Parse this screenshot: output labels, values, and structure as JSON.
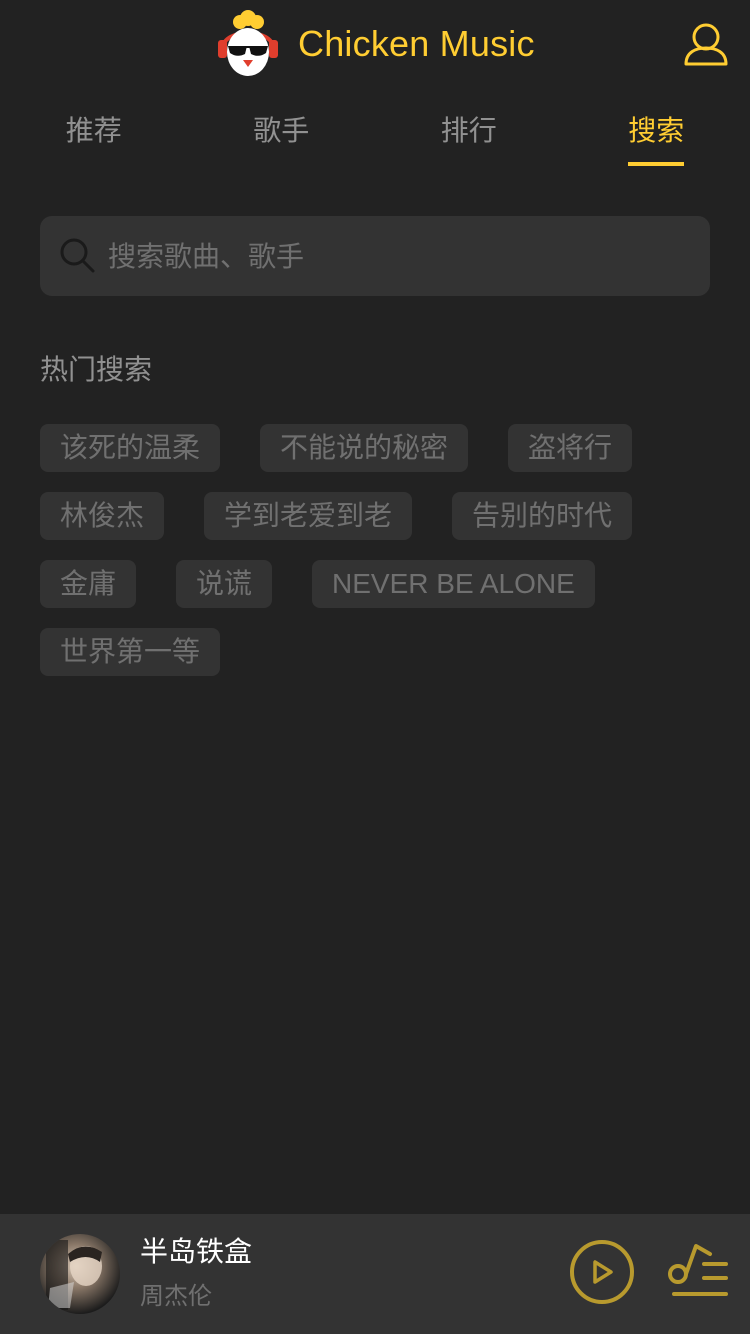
{
  "header": {
    "title": "Chicken Music",
    "logo_icon": "chicken-logo-icon",
    "user_icon": "user-icon"
  },
  "tabs": [
    {
      "label": "推荐",
      "active": false
    },
    {
      "label": "歌手",
      "active": false
    },
    {
      "label": "排行",
      "active": false
    },
    {
      "label": "搜索",
      "active": true
    }
  ],
  "search": {
    "icon": "search-icon",
    "placeholder": "搜索歌曲、歌手",
    "value": ""
  },
  "hot_search": {
    "title": "热门搜索",
    "items": [
      "该死的温柔",
      "不能说的秘密",
      "盗将行",
      "林俊杰",
      "学到老爱到老",
      "告别的时代",
      "金庸",
      "说谎",
      "NEVER BE ALONE",
      "世界第一等"
    ]
  },
  "mini_player": {
    "song_name": "半岛铁盒",
    "singer": "周杰伦",
    "play_icon": "play-icon",
    "playlist_icon": "playlist-icon"
  },
  "colors": {
    "background": "#222222",
    "surface": "#333333",
    "accent": "#ffcd32",
    "accent_dim": "#b89a2e"
  }
}
